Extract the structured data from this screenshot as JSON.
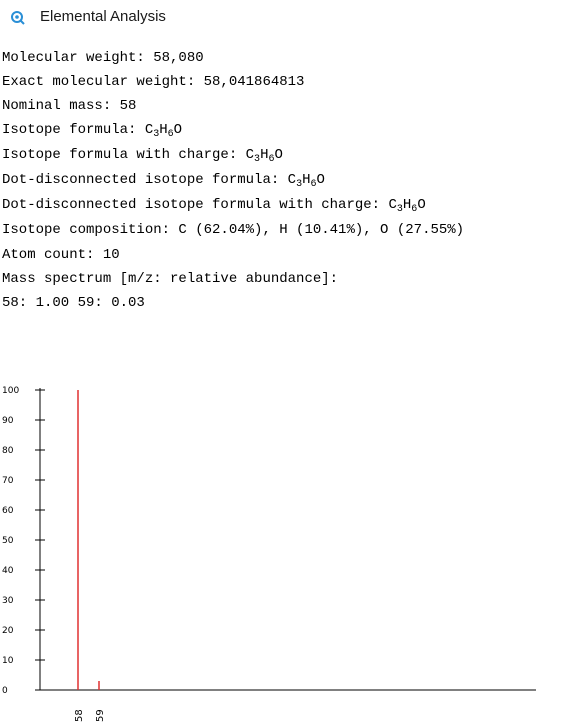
{
  "window": {
    "title": "Elemental Analysis",
    "icon": "elemental-analysis-icon"
  },
  "info": {
    "molecular_weight": "Molecular weight: 58,080",
    "exact_molecular_weight": "Exact molecular weight: 58,041864813",
    "nominal_mass": "Nominal mass: 58",
    "isotope_formula_label": "Isotope formula: ",
    "isotope_formula_charge_label": "Isotope formula with charge: ",
    "dot_disconnected_label": "Dot-disconnected isotope formula: ",
    "dot_disconnected_charge_label": "Dot-disconnected isotope formula with charge: ",
    "formula": {
      "c": "C",
      "c_sub": "3",
      "h": "H",
      "h_sub": "6",
      "o": "O"
    },
    "isotope_composition": "Isotope composition: C (62.04%), H (10.41%), O (27.55%)",
    "atom_count": "Atom count: 10",
    "mass_spectrum_label": "Mass spectrum [m/z: relative abundance]:",
    "mass_spectrum_values": "58: 1.00 59: 0.03"
  },
  "chart_data": {
    "type": "bar",
    "categories": [
      "58",
      "59"
    ],
    "values": [
      100,
      3
    ],
    "y_ticks": [
      "0",
      "10",
      "20",
      "30",
      "40",
      "50",
      "60",
      "70",
      "80",
      "90",
      "100"
    ],
    "ylim": [
      0,
      100
    ],
    "bar_color": "#e03030",
    "title": "",
    "xlabel": "",
    "ylabel": ""
  }
}
